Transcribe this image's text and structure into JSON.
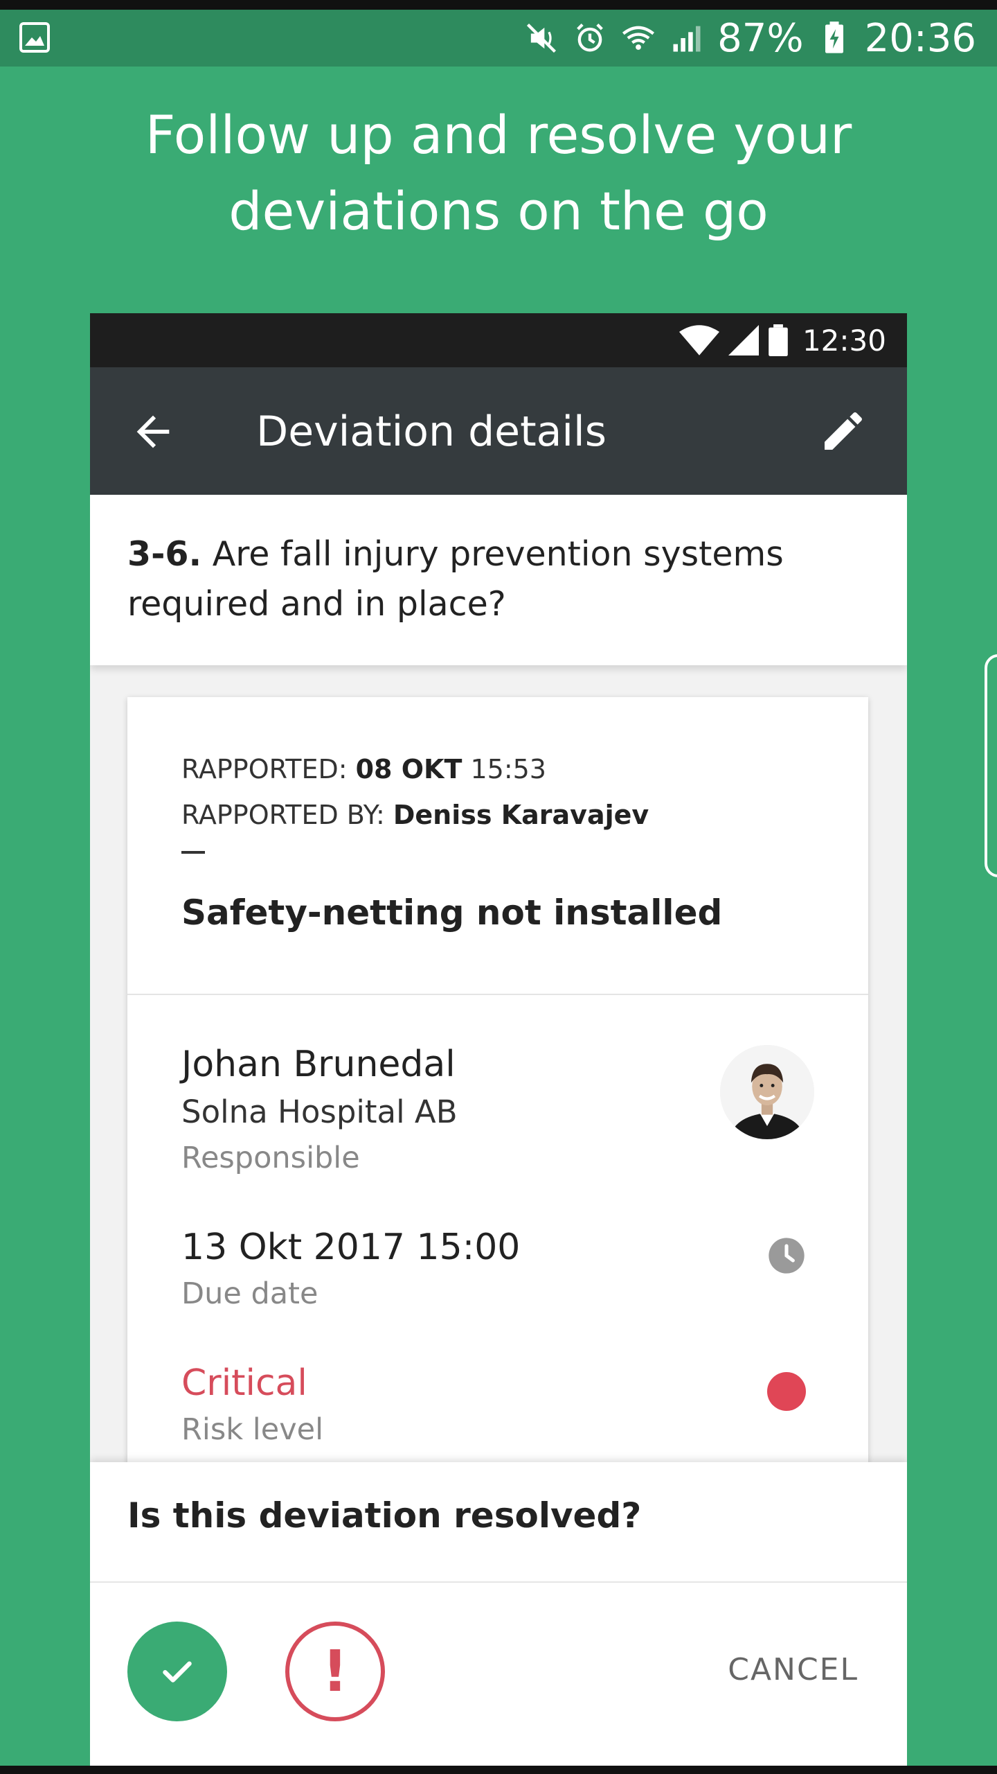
{
  "status_bar": {
    "battery": "87%",
    "time": "20:36"
  },
  "headline": {
    "line1": "Follow up and resolve your",
    "line2": "deviations on the go"
  },
  "phone": {
    "status_time": "12:30",
    "appbar_title": "Deviation details",
    "question": {
      "number": "3-6.",
      "text": " Are fall injury prevention systems required and in place?"
    },
    "details": {
      "reported_label": "RAPPORTED: ",
      "reported_date": "08 OKT",
      "reported_time": " 15:53",
      "reported_by_label": "RAPPORTED BY: ",
      "reported_by": "Deniss Karavajev",
      "summary": "Safety-netting not installed",
      "responsible_name": "Johan Brunedal",
      "responsible_org": "Solna Hospital AB",
      "responsible_role": "Responsible",
      "due_date": "13 Okt 2017 15:00",
      "due_label": "Due date",
      "risk_value": "Critical",
      "risk_label": "Risk level"
    },
    "sheet": {
      "question": "Is this deviation resolved?",
      "unresolved_symbol": "!",
      "cancel": "CANCEL"
    }
  },
  "colors": {
    "background": "#3aab74",
    "status_bar": "#2e8b5e",
    "appbar": "#353b3e",
    "critical": "#d64c5b",
    "resolved": "#3aab74"
  },
  "icons": [
    "gallery-icon",
    "mute-icon",
    "alarm-icon",
    "wifi-icon",
    "signal-icon",
    "battery-charging-icon",
    "back-arrow-icon",
    "edit-pencil-icon",
    "clock-icon",
    "check-icon"
  ]
}
